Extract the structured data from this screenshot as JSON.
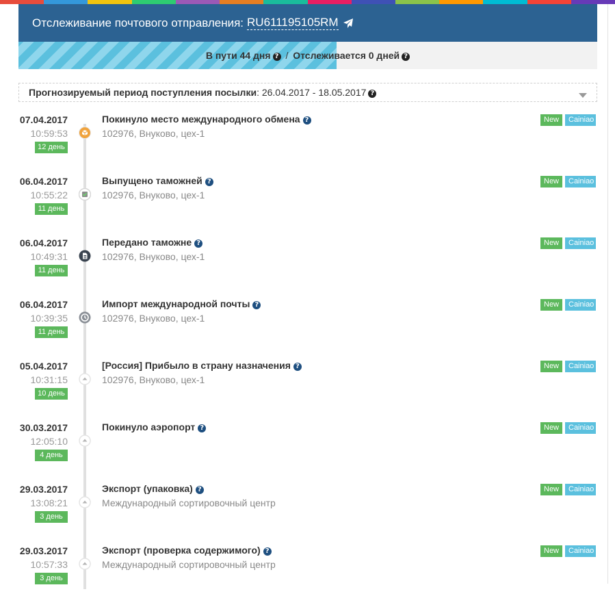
{
  "colors": {
    "header_bg": "#2c6292",
    "progress_fill": "#5bc0de",
    "day_badge": "#5cb85c",
    "source_badge": "#5bc0de",
    "stripe": [
      "#e74c3c",
      "#3498db",
      "#f1c40f",
      "#2ecc71",
      "#9b59b6",
      "#e67e22",
      "#1abc9c",
      "#e91e63",
      "#3f51b5",
      "#8bc34a",
      "#ff9800",
      "#00bcd4",
      "#f44336",
      "#673ab7"
    ]
  },
  "header": {
    "title": "Отслеживание почтового отправления:",
    "track_number": "RU611195105RM",
    "share_icon": "paper-plane-icon"
  },
  "progress": {
    "in_transit": "В пути 44 дня",
    "separator": "/",
    "tracked": "Отслеживается 0 дней",
    "fill_fraction": 0.55,
    "help_icon": "question-circle-icon"
  },
  "forecast": {
    "label": "Прогнозируемый период поступления посылки",
    "value": ": 26.04.2017 - 18.05.2017",
    "expand_icon": "caret-down-icon"
  },
  "events": [
    {
      "date": "07.04.2017",
      "time": "10:59:53",
      "day": "12 день",
      "status": "Покинуло место международного обмена",
      "location": "102976, Внуково, цех-1",
      "badge_new": "New",
      "badge_source": "Cainiao",
      "icon": "box-icon"
    },
    {
      "date": "06.04.2017",
      "time": "10:55:22",
      "day": "11 день",
      "status": "Выпущено таможней",
      "location": "102976, Внуково, цех-1",
      "badge_new": "New",
      "badge_source": "Cainiao",
      "icon": "check-icon"
    },
    {
      "date": "06.04.2017",
      "time": "10:49:31",
      "day": "11 день",
      "status": "Передано таможне",
      "location": "102976, Внуково, цех-1",
      "badge_new": "New",
      "badge_source": "Cainiao",
      "icon": "document-icon"
    },
    {
      "date": "06.04.2017",
      "time": "10:39:35",
      "day": "11 день",
      "status": "Импорт международной почты",
      "location": "102976, Внуково, цех-1",
      "badge_new": "New",
      "badge_source": "Cainiao",
      "icon": "clock-icon"
    },
    {
      "date": "05.04.2017",
      "time": "10:31:15",
      "day": "10 день",
      "status": "[Россия] Прибыло в страну назначения",
      "location": "102976, Внуково, цех-1",
      "badge_new": "New",
      "badge_source": "Cainiao",
      "icon": "triangle-up-icon"
    },
    {
      "date": "30.03.2017",
      "time": "12:05:10",
      "day": "4 день",
      "status": "Покинуло аэропорт",
      "location": "",
      "badge_new": "New",
      "badge_source": "Cainiao",
      "icon": "triangle-up-icon"
    },
    {
      "date": "29.03.2017",
      "time": "13:08:21",
      "day": "3 день",
      "status": "Экспорт (упаковка)",
      "location": "Международный сортировочный центр",
      "badge_new": "New",
      "badge_source": "Cainiao",
      "icon": "triangle-up-icon"
    },
    {
      "date": "29.03.2017",
      "time": "10:57:33",
      "day": "3 день",
      "status": "Экспорт (проверка содержимого)",
      "location": "Международный сортировочный центр",
      "badge_new": "New",
      "badge_source": "Cainiao",
      "icon": "triangle-up-icon"
    }
  ]
}
